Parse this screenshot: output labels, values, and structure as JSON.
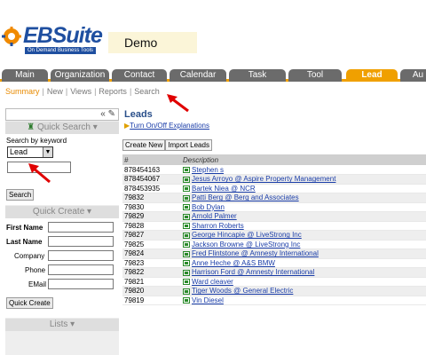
{
  "header": {
    "logo_text": "EBSuite",
    "logo_tagline": "On Demand Business Tools",
    "instance_name": "Demo"
  },
  "tabs": [
    {
      "label": "Main"
    },
    {
      "label": "Organization"
    },
    {
      "label": "Contact"
    },
    {
      "label": "Calendar"
    },
    {
      "label": "Task"
    },
    {
      "label": "Tool"
    },
    {
      "label": "Lead",
      "active": true
    },
    {
      "label": "Au"
    }
  ],
  "subnav": {
    "items": [
      "Summary",
      "New",
      "Views",
      "Reports",
      "Search"
    ],
    "active": "Summary"
  },
  "sidebar": {
    "collapse_glyph": "« ✎",
    "quick_search": {
      "title": "Quick Search ▾",
      "keyword_label": "Search by keyword",
      "module_selected": "Lead",
      "search_value": "",
      "search_button": "Search"
    },
    "quick_create": {
      "title": "Quick Create ▾",
      "fields": [
        {
          "label": "First Name",
          "value": ""
        },
        {
          "label": "Last Name",
          "value": ""
        },
        {
          "label": "Company",
          "value": ""
        },
        {
          "label": "Phone",
          "value": ""
        },
        {
          "label": "EMail",
          "value": ""
        }
      ],
      "button": "Quick Create"
    },
    "lists": {
      "title": "Lists ▾"
    }
  },
  "main": {
    "title": "Leads",
    "explain_link": "Turn On/Off Explanations",
    "create_button": "Create New",
    "import_button": "Import Leads",
    "columns": [
      "#",
      "Description"
    ],
    "rows": [
      {
        "id": "878454163",
        "desc": "Stephen s"
      },
      {
        "id": "878454067",
        "desc": "Jesus Arroyo @ Aspire Property Management"
      },
      {
        "id": "878453935",
        "desc": "Bartek Niea @ NCR"
      },
      {
        "id": "79832",
        "desc": "Patti Berg @ Berg and Associates"
      },
      {
        "id": "79830",
        "desc": "Bob Dylan"
      },
      {
        "id": "79829",
        "desc": "Arnold Palmer"
      },
      {
        "id": "79828",
        "desc": "Sharron Roberts"
      },
      {
        "id": "79827",
        "desc": "George Hincapie @ LiveStrong Inc"
      },
      {
        "id": "79825",
        "desc": "Jackson Browne @ LiveStrong Inc"
      },
      {
        "id": "79824",
        "desc": "Fred Flintstone @ Amnesty International"
      },
      {
        "id": "79823",
        "desc": "Anne Heche @ A&S BMW"
      },
      {
        "id": "79822",
        "desc": "Harrison Ford @ Amnesty International"
      },
      {
        "id": "79821",
        "desc": "Ward cleaver"
      },
      {
        "id": "79820",
        "desc": "Tiger Woods @ General Electric"
      },
      {
        "id": "79819",
        "desc": "Vin Diesel"
      }
    ]
  },
  "colors": {
    "brand_blue": "#1f4fa0",
    "tab_active": "#f0a000",
    "tab_inactive": "#6b6b6b",
    "annotation_arrow": "#e00000"
  }
}
